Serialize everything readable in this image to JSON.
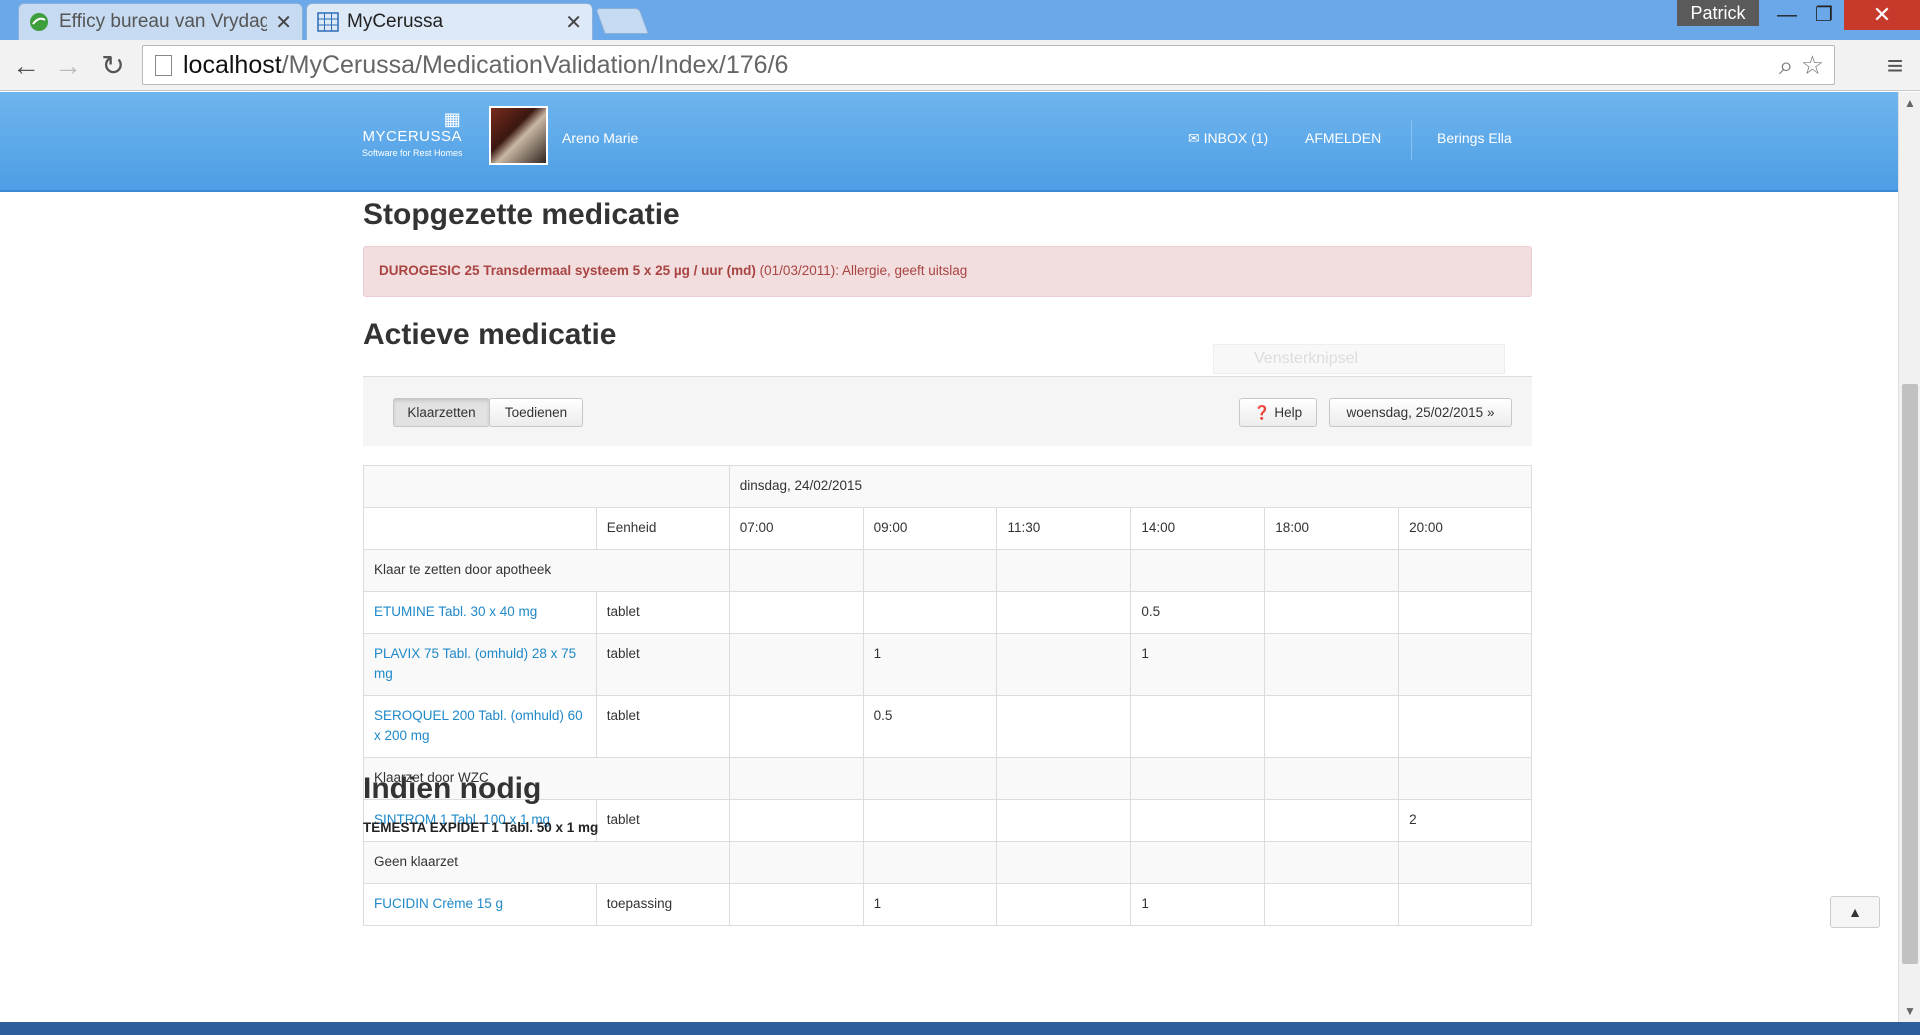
{
  "browser": {
    "tabs": [
      {
        "title": "Efficy bureau van Vrydagh",
        "icon": "efficy-icon"
      },
      {
        "title": "MyCerussa",
        "icon": "grid-icon"
      }
    ],
    "profile": "Patrick",
    "url_host": "localhost",
    "url_path": "/MyCerussa/MedicationValidation/Index/176/6",
    "controls": {
      "minimize": "—",
      "maximize": "❐",
      "close": "✕"
    }
  },
  "app": {
    "brand_name": "MYCERUSSA",
    "brand_tagline": "Software for Rest Homes",
    "resident": "Areno Marie",
    "inbox": "INBOX (1)",
    "logout": "AFMELDEN",
    "user": "Berings Ella"
  },
  "stopped": {
    "title": "Stopgezette medicatie",
    "drug": "DUROGESIC 25 Transdermaal systeem 5 x 25 µg / uur (md)",
    "detail": " (01/03/2011): Allergie, geeft uitslag"
  },
  "overlay_snip": "Vensterknipsel",
  "active": {
    "title": "Actieve medicatie",
    "tab_prepare": "Klaarzetten",
    "tab_administer": "Toedienen",
    "help": "Help",
    "next_date": "woensdag, 25/02/2015",
    "next_arrow": "»",
    "date_header": "dinsdag, 24/02/2015",
    "unit_header": "Eenheid",
    "times": [
      "07:00",
      "09:00",
      "11:30",
      "14:00",
      "18:00",
      "20:00"
    ],
    "rows": [
      {
        "type": "group",
        "label": "Klaar te zetten door apotheek"
      },
      {
        "type": "item",
        "name": "ETUMINE Tabl. 30 x 40 mg",
        "unit": "tablet",
        "doses": [
          "",
          "",
          "",
          "0.5",
          "",
          ""
        ]
      },
      {
        "type": "item",
        "name": "PLAVIX 75 Tabl. (omhuld) 28 x 75 mg",
        "unit": "tablet",
        "doses": [
          "",
          "1",
          "",
          "1",
          "",
          ""
        ]
      },
      {
        "type": "item",
        "name": "SEROQUEL 200 Tabl. (omhuld) 60 x 200 mg",
        "unit": "tablet",
        "doses": [
          "",
          "0.5",
          "",
          "",
          "",
          ""
        ]
      },
      {
        "type": "group",
        "label": "Klaarzet door WZC"
      },
      {
        "type": "item",
        "name": "SINTROM 1 Tabl. 100 x 1 mg",
        "unit": "tablet",
        "doses": [
          "",
          "",
          "",
          "",
          "",
          "2"
        ]
      },
      {
        "type": "group",
        "label": "Geen klaarzet"
      },
      {
        "type": "item",
        "name": "FUCIDIN Crème 15 g",
        "unit": "toepassing",
        "doses": [
          "",
          "1",
          "",
          "1",
          "",
          ""
        ]
      }
    ]
  },
  "as_needed": {
    "title": "Indien nodig",
    "first_item": "TEMESTA EXPIDET 1 Tabl. 50 x 1 mg"
  }
}
